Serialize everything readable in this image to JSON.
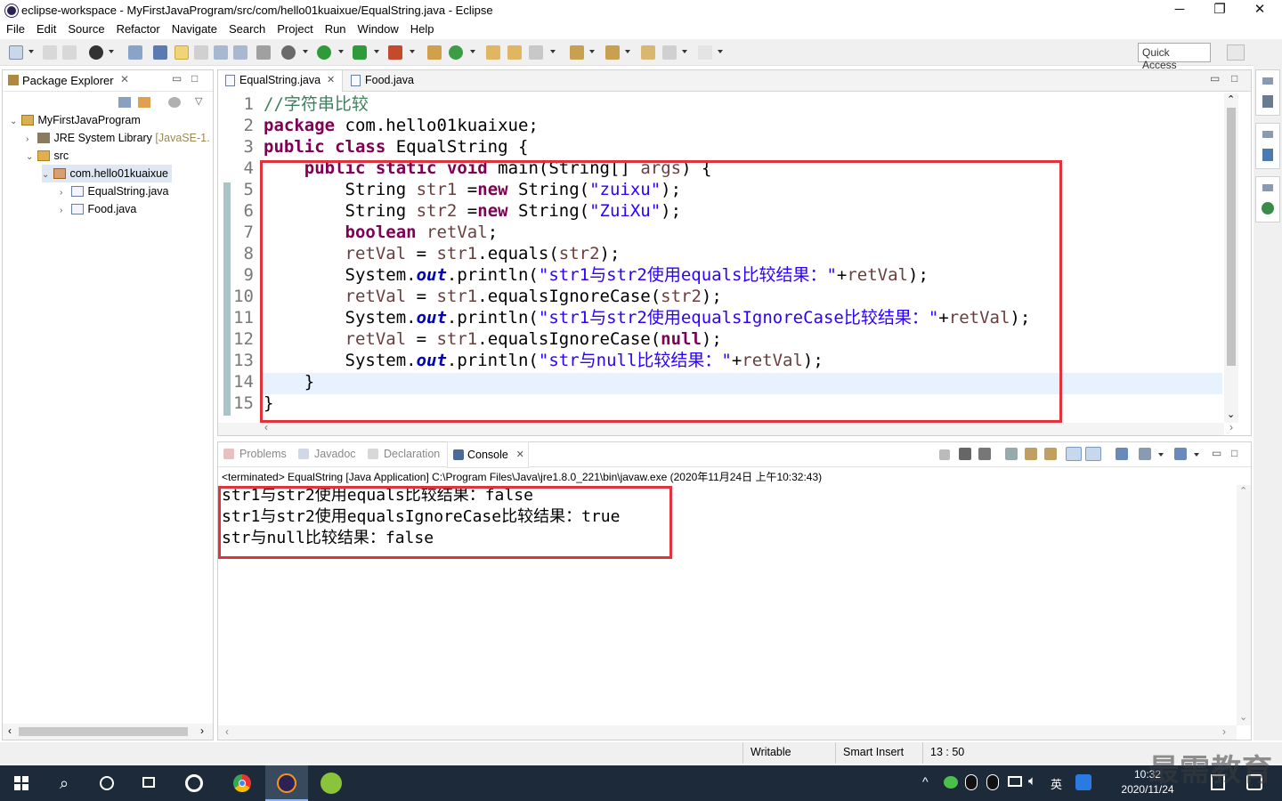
{
  "window": {
    "title": "eclipse-workspace - MyFirstJavaProgram/src/com/hello01kuaixue/EqualString.java - Eclipse",
    "minimize_glyph": "─",
    "restore_glyph": "❐",
    "close_glyph": "✕"
  },
  "menu": [
    "File",
    "Edit",
    "Source",
    "Refactor",
    "Navigate",
    "Search",
    "Project",
    "Run",
    "Window",
    "Help"
  ],
  "toolbar": {
    "quick_access": "Quick Access"
  },
  "package_explorer": {
    "title": "Package Explorer",
    "tree": [
      {
        "label": "MyFirstJavaProgram",
        "level": 0,
        "expanded": true,
        "icon": "project-icon"
      },
      {
        "label": "JRE System Library",
        "suffix": "[JavaSE-1.",
        "level": 1,
        "expanded": false,
        "icon": "library-icon"
      },
      {
        "label": "src",
        "level": 1,
        "expanded": true,
        "icon": "source-folder-icon"
      },
      {
        "label": "com.hello01kuaixue",
        "level": 2,
        "expanded": true,
        "icon": "package-icon",
        "selected": true
      },
      {
        "label": "EqualString.java",
        "level": 3,
        "expanded": false,
        "icon": "java-file-icon"
      },
      {
        "label": "Food.java",
        "level": 3,
        "expanded": false,
        "icon": "java-file-icon"
      }
    ]
  },
  "editor": {
    "tabs": [
      {
        "label": "EqualString.java",
        "active": true,
        "closable": true
      },
      {
        "label": "Food.java",
        "active": false,
        "closable": false
      }
    ],
    "line_numbers": [
      "1",
      "2",
      "3",
      "4",
      "5",
      "6",
      "7",
      "8",
      "9",
      "10",
      "11",
      "12",
      "13",
      "14",
      "15"
    ],
    "lines": [
      [
        {
          "t": "//字符串比较",
          "c": "cmt"
        }
      ],
      [
        {
          "t": "package",
          "c": "kw"
        },
        {
          "t": " com.hello01kuaixue;",
          "c": ""
        }
      ],
      [
        {
          "t": "public",
          "c": "kw"
        },
        {
          "t": " ",
          "c": ""
        },
        {
          "t": "class",
          "c": "kw"
        },
        {
          "t": " EqualString {",
          "c": ""
        }
      ],
      [
        {
          "t": "    ",
          "c": ""
        },
        {
          "t": "public",
          "c": "kw"
        },
        {
          "t": " ",
          "c": ""
        },
        {
          "t": "static",
          "c": "kw"
        },
        {
          "t": " ",
          "c": ""
        },
        {
          "t": "void",
          "c": "kw"
        },
        {
          "t": " main(String[] ",
          "c": ""
        },
        {
          "t": "args",
          "c": "var"
        },
        {
          "t": ") {",
          "c": ""
        }
      ],
      [
        {
          "t": "        String ",
          "c": ""
        },
        {
          "t": "str1",
          "c": "var"
        },
        {
          "t": " =",
          "c": ""
        },
        {
          "t": "new",
          "c": "kw"
        },
        {
          "t": " String(",
          "c": ""
        },
        {
          "t": "\"zuixu\"",
          "c": "str"
        },
        {
          "t": ");",
          "c": ""
        }
      ],
      [
        {
          "t": "        String ",
          "c": ""
        },
        {
          "t": "str2",
          "c": "var"
        },
        {
          "t": " =",
          "c": ""
        },
        {
          "t": "new",
          "c": "kw"
        },
        {
          "t": " String(",
          "c": ""
        },
        {
          "t": "\"ZuiXu\"",
          "c": "str"
        },
        {
          "t": ");",
          "c": ""
        }
      ],
      [
        {
          "t": "        ",
          "c": ""
        },
        {
          "t": "boolean",
          "c": "kw"
        },
        {
          "t": " ",
          "c": ""
        },
        {
          "t": "retVal",
          "c": "var"
        },
        {
          "t": ";",
          "c": ""
        }
      ],
      [
        {
          "t": "        ",
          "c": ""
        },
        {
          "t": "retVal",
          "c": "var"
        },
        {
          "t": " = ",
          "c": ""
        },
        {
          "t": "str1",
          "c": "var"
        },
        {
          "t": ".equals(",
          "c": ""
        },
        {
          "t": "str2",
          "c": "var"
        },
        {
          "t": ");",
          "c": ""
        }
      ],
      [
        {
          "t": "        System.",
          "c": ""
        },
        {
          "t": "out",
          "c": "fld"
        },
        {
          "t": ".println(",
          "c": ""
        },
        {
          "t": "\"str1与str2使用equals比较结果：\"",
          "c": "str"
        },
        {
          "t": "+",
          "c": ""
        },
        {
          "t": "retVal",
          "c": "var"
        },
        {
          "t": ");",
          "c": ""
        }
      ],
      [
        {
          "t": "        ",
          "c": ""
        },
        {
          "t": "retVal",
          "c": "var"
        },
        {
          "t": " = ",
          "c": ""
        },
        {
          "t": "str1",
          "c": "var"
        },
        {
          "t": ".equalsIgnoreCase(",
          "c": ""
        },
        {
          "t": "str2",
          "c": "var"
        },
        {
          "t": ");",
          "c": ""
        }
      ],
      [
        {
          "t": "        System.",
          "c": ""
        },
        {
          "t": "out",
          "c": "fld"
        },
        {
          "t": ".println(",
          "c": ""
        },
        {
          "t": "\"str1与str2使用equalsIgnoreCase比较结果：\"",
          "c": "str"
        },
        {
          "t": "+",
          "c": ""
        },
        {
          "t": "retVal",
          "c": "var"
        },
        {
          "t": ");",
          "c": ""
        }
      ],
      [
        {
          "t": "        ",
          "c": ""
        },
        {
          "t": "retVal",
          "c": "var"
        },
        {
          "t": " = ",
          "c": ""
        },
        {
          "t": "str1",
          "c": "var"
        },
        {
          "t": ".equalsIgnoreCase(",
          "c": ""
        },
        {
          "t": "null",
          "c": "kw"
        },
        {
          "t": ");",
          "c": ""
        }
      ],
      [
        {
          "t": "        System.",
          "c": ""
        },
        {
          "t": "out",
          "c": "fld"
        },
        {
          "t": ".println(",
          "c": ""
        },
        {
          "t": "\"str与null比较结果：\"",
          "c": "str"
        },
        {
          "t": "+",
          "c": ""
        },
        {
          "t": "retVal",
          "c": "var"
        },
        {
          "t": ");",
          "c": ""
        }
      ],
      [
        {
          "t": "    }",
          "c": ""
        }
      ],
      [
        {
          "t": "}",
          "c": ""
        }
      ]
    ]
  },
  "console": {
    "tabs": [
      {
        "label": "Problems",
        "active": false
      },
      {
        "label": "Javadoc",
        "active": false
      },
      {
        "label": "Declaration",
        "active": false
      },
      {
        "label": "Console",
        "active": true
      }
    ],
    "status": "<terminated> EqualString [Java Application] C:\\Program Files\\Java\\jre1.8.0_221\\bin\\javaw.exe (2020年11月24日 上午10:32:43)",
    "output": [
      "str1与str2使用equals比较结果：false",
      "str1与str2使用equalsIgnoreCase比较结果：true",
      "str与null比较结果：false"
    ]
  },
  "statusbar": {
    "mode": "Writable",
    "insert": "Smart Insert",
    "position": "13 : 50"
  },
  "taskbar": {
    "time": "10:32",
    "date": "2020/11/24",
    "ime": "英"
  },
  "watermark": "最需教育",
  "colors": {
    "highlight_box": "#e0333b",
    "keyword": "#7f0055",
    "string": "#2a00ff",
    "comment": "#3f7f5f",
    "taskbar": "#1c2a3a"
  }
}
